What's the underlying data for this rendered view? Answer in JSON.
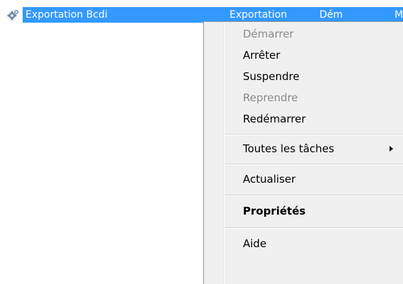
{
  "row": {
    "icon": "gear-icon",
    "name": "Exportation Bcdi",
    "description": "Exportation",
    "status": "Dém",
    "more": "M"
  },
  "menu": {
    "items": [
      {
        "label": "Démarrer",
        "enabled": false
      },
      {
        "label": "Arrêter",
        "enabled": true
      },
      {
        "label": "Suspendre",
        "enabled": true
      },
      {
        "label": "Reprendre",
        "enabled": false
      },
      {
        "label": "Redémarrer",
        "enabled": true
      },
      {
        "label": "Toutes les tâches",
        "enabled": true,
        "submenu": true
      },
      {
        "label": "Actualiser",
        "enabled": true
      },
      {
        "label": "Propriétés",
        "enabled": true,
        "default": true
      },
      {
        "label": "Aide",
        "enabled": true
      }
    ],
    "submenu_icon": "chevron-right-icon"
  },
  "colors": {
    "selection": "#3399ff",
    "menu_background": "#f0f0f0",
    "disabled_text": "#8a8a8a"
  }
}
